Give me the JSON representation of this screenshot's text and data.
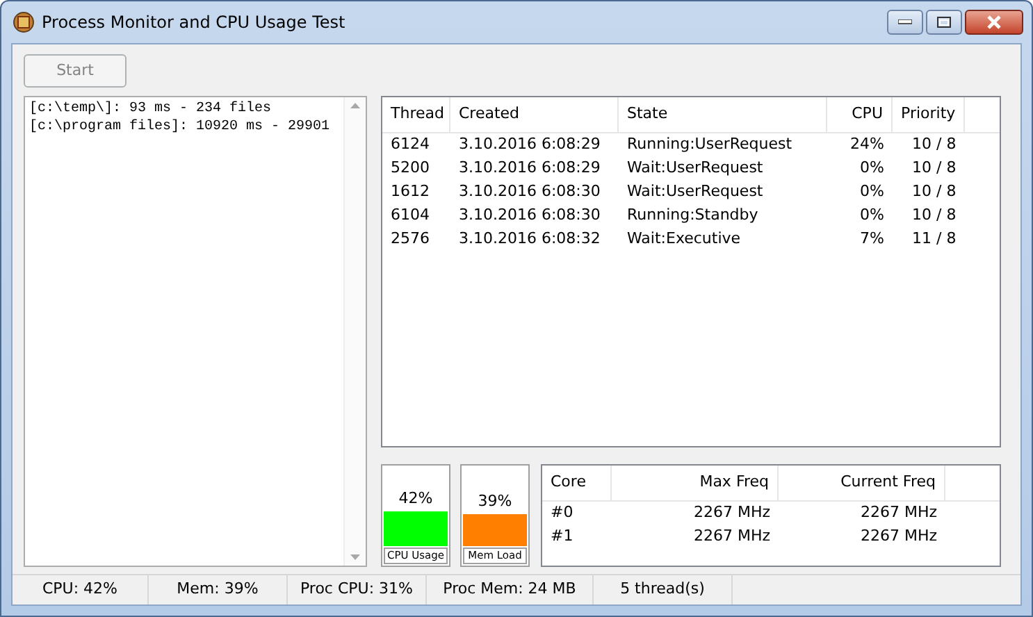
{
  "window": {
    "title": "Process Monitor and CPU Usage Test"
  },
  "start_button": {
    "label": "Start",
    "disabled": true
  },
  "log": {
    "lines": [
      "[c:\\temp\\]: 93 ms - 234 files",
      "[c:\\program files]: 10920 ms - 29901"
    ]
  },
  "threads": {
    "columns": [
      "Thread",
      "Created",
      "State",
      "CPU",
      "Priority"
    ],
    "rows": [
      [
        "6124",
        "3.10.2016 6:08:29",
        "Running:UserRequest",
        "24%",
        "10 / 8"
      ],
      [
        "5200",
        "3.10.2016 6:08:29",
        "Wait:UserRequest",
        "0%",
        "10 / 8"
      ],
      [
        "1612",
        "3.10.2016 6:08:30",
        "Wait:UserRequest",
        "0%",
        "10 / 8"
      ],
      [
        "6104",
        "3.10.2016 6:08:30",
        "Running:Standby",
        "0%",
        "10 / 8"
      ],
      [
        "2576",
        "3.10.2016 6:08:32",
        "Wait:Executive",
        "7%",
        "11 / 8"
      ]
    ]
  },
  "gauges": [
    {
      "label": "CPU Usage",
      "reading": "42%",
      "level": 0.42,
      "color": "#00ff00"
    },
    {
      "label": "Mem Load",
      "reading": "39%",
      "level": 0.39,
      "color": "#ff8000"
    }
  ],
  "cores": {
    "columns": [
      "Core",
      "Max Freq",
      "Current Freq"
    ],
    "rows": [
      [
        "#0",
        "2267 MHz",
        "2267 MHz"
      ],
      [
        "#1",
        "2267 MHz",
        "2267 MHz"
      ]
    ]
  },
  "status_bar": [
    "CPU: 42%",
    "Mem: 39%",
    "Proc CPU: 31%",
    "Proc Mem: 24 MB",
    "5 thread(s)"
  ]
}
